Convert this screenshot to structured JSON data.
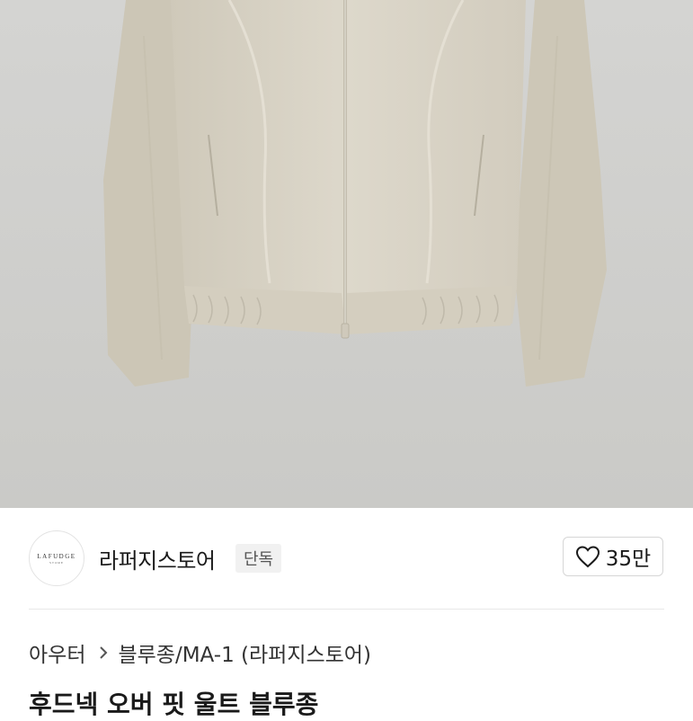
{
  "store": {
    "logo_text": "LAFUDGE",
    "logo_subtext": "STORE",
    "name": "라퍼지스토어",
    "badge": "단독"
  },
  "like": {
    "count": "35만",
    "icon": "heart-outline-icon"
  },
  "breadcrumb": {
    "parent": "아우터",
    "current": "블루종/MA-1 (라퍼지스토어)"
  },
  "product": {
    "title_partial": "후드넥 오버 핏 울트 블루종"
  },
  "colors": {
    "jacket": "#d6d1c3",
    "background": "#d0d0ce"
  }
}
